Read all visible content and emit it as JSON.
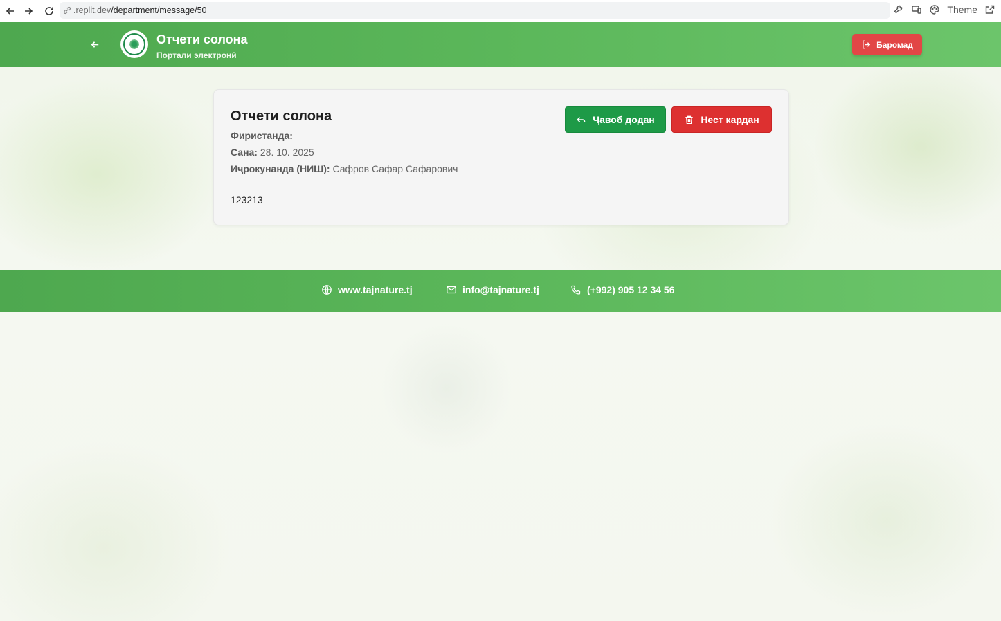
{
  "browser": {
    "url_host": ".replit.dev",
    "url_path": "/department/message/50",
    "theme_label": "Theme"
  },
  "header": {
    "title": "Отчети солона",
    "subtitle": "Портали электронӣ",
    "logout_label": "Баромад"
  },
  "message": {
    "title": "Отчети солона",
    "sender_key": "Фиристанда:",
    "sender_value": "",
    "date_key": "Сана:",
    "date_value": "28. 10. 2025",
    "executor_key": "Иҷрокунанда (НИШ):",
    "executor_value": "Сафров Сафар Сафарович",
    "body": "123213",
    "reply_label": "Ҷавоб додан",
    "delete_label": "Нест кардан"
  },
  "footer": {
    "website": "www.tajnature.tj",
    "email": "info@tajnature.tj",
    "phone": "(+992) 905 12 34 56"
  },
  "colors": {
    "header_green": "#5bb75a",
    "reply_green": "#1e9a47",
    "delete_red": "#dd3030",
    "logout_red": "#e24646"
  }
}
